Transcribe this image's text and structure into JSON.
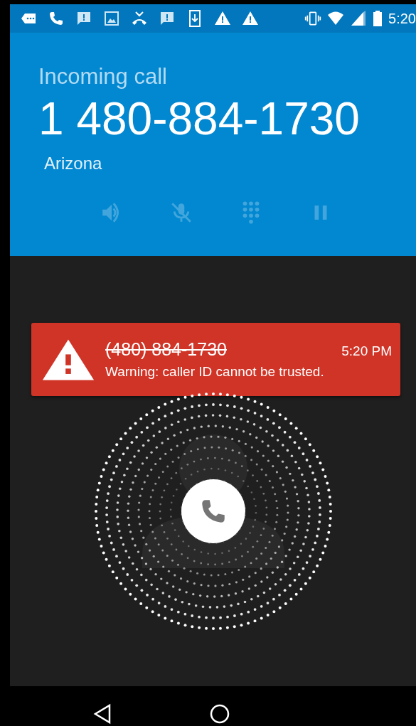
{
  "status_bar": {
    "time": "5:20"
  },
  "call": {
    "status": "Incoming call",
    "number": "1 480-884-1730",
    "location": "Arizona"
  },
  "controls": [
    {
      "kind": "speaker",
      "disabled": true
    },
    {
      "kind": "mute",
      "disabled": true
    },
    {
      "kind": "dialpad",
      "disabled": true
    },
    {
      "kind": "hold",
      "disabled": true
    }
  ],
  "warning": {
    "number": "(480) 884-1730",
    "time": "5:20 PM",
    "message": "Warning: caller ID cannot be trusted."
  }
}
